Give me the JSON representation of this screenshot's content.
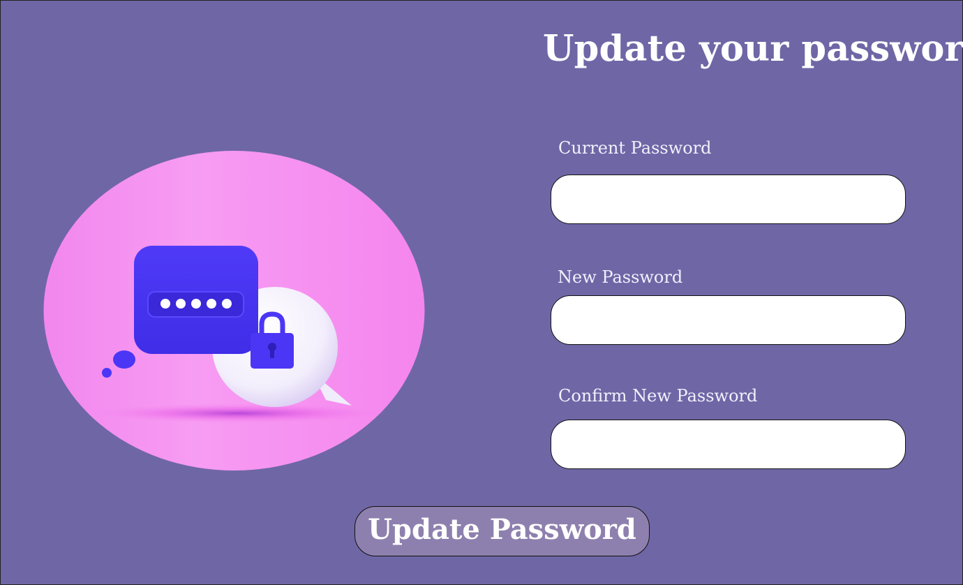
{
  "page": {
    "title": "Update your password"
  },
  "form": {
    "current_password_label": "Current Password",
    "current_password_value": "",
    "new_password_label": "New Password",
    "new_password_value": "",
    "confirm_password_label": "Confirm New Password",
    "confirm_password_value": "",
    "submit_label": "Update Password"
  },
  "illustration": {
    "masked_password": "*****",
    "icons": [
      "password-chat-bubble-icon",
      "padlock-icon",
      "thought-bubble-icon"
    ]
  },
  "colors": {
    "background": "#6f66a6",
    "accent_blue": "#4b36f5",
    "circle_pink": "#f58af0",
    "button": "#8e80ae"
  }
}
